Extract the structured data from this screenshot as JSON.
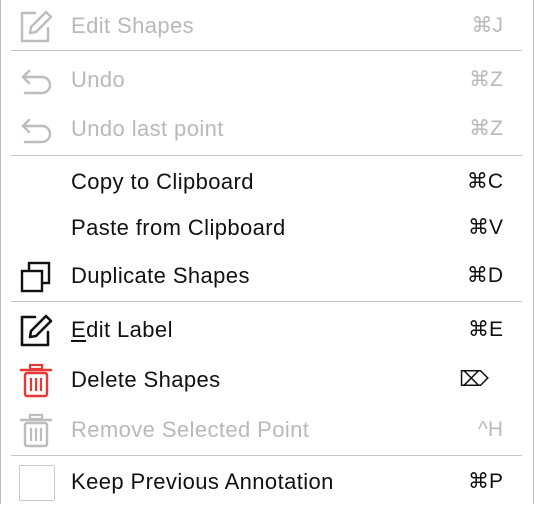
{
  "menu": {
    "items": [
      {
        "label": "Edit Shapes",
        "shortcut": "⌘J",
        "icon": "edit-shapes-icon",
        "enabled": false
      },
      {
        "label": "Undo",
        "shortcut": "⌘Z",
        "icon": "undo-icon",
        "enabled": false
      },
      {
        "label": "Undo last point",
        "shortcut": "⌘Z",
        "icon": "undo-icon",
        "enabled": false
      },
      {
        "label": "Copy to Clipboard",
        "shortcut": "⌘C",
        "enabled": true
      },
      {
        "label": "Paste from Clipboard",
        "shortcut": "⌘V",
        "enabled": true
      },
      {
        "label": "Duplicate Shapes",
        "shortcut": "⌘D",
        "icon": "duplicate-icon",
        "enabled": true
      },
      {
        "label_first": "E",
        "label_rest": "dit Label",
        "shortcut": "⌘E",
        "icon": "edit-label-icon",
        "enabled": true
      },
      {
        "label": "Delete Shapes",
        "shortcut": "⌦",
        "icon": "trash-icon",
        "icon_color": "#e53935",
        "enabled": true
      },
      {
        "label": "Remove Selected Point",
        "shortcut": "^H",
        "icon": "trash-icon",
        "enabled": false
      },
      {
        "label": "Keep Previous Annotation",
        "shortcut": "⌘P",
        "checked": false,
        "enabled": true
      }
    ]
  }
}
